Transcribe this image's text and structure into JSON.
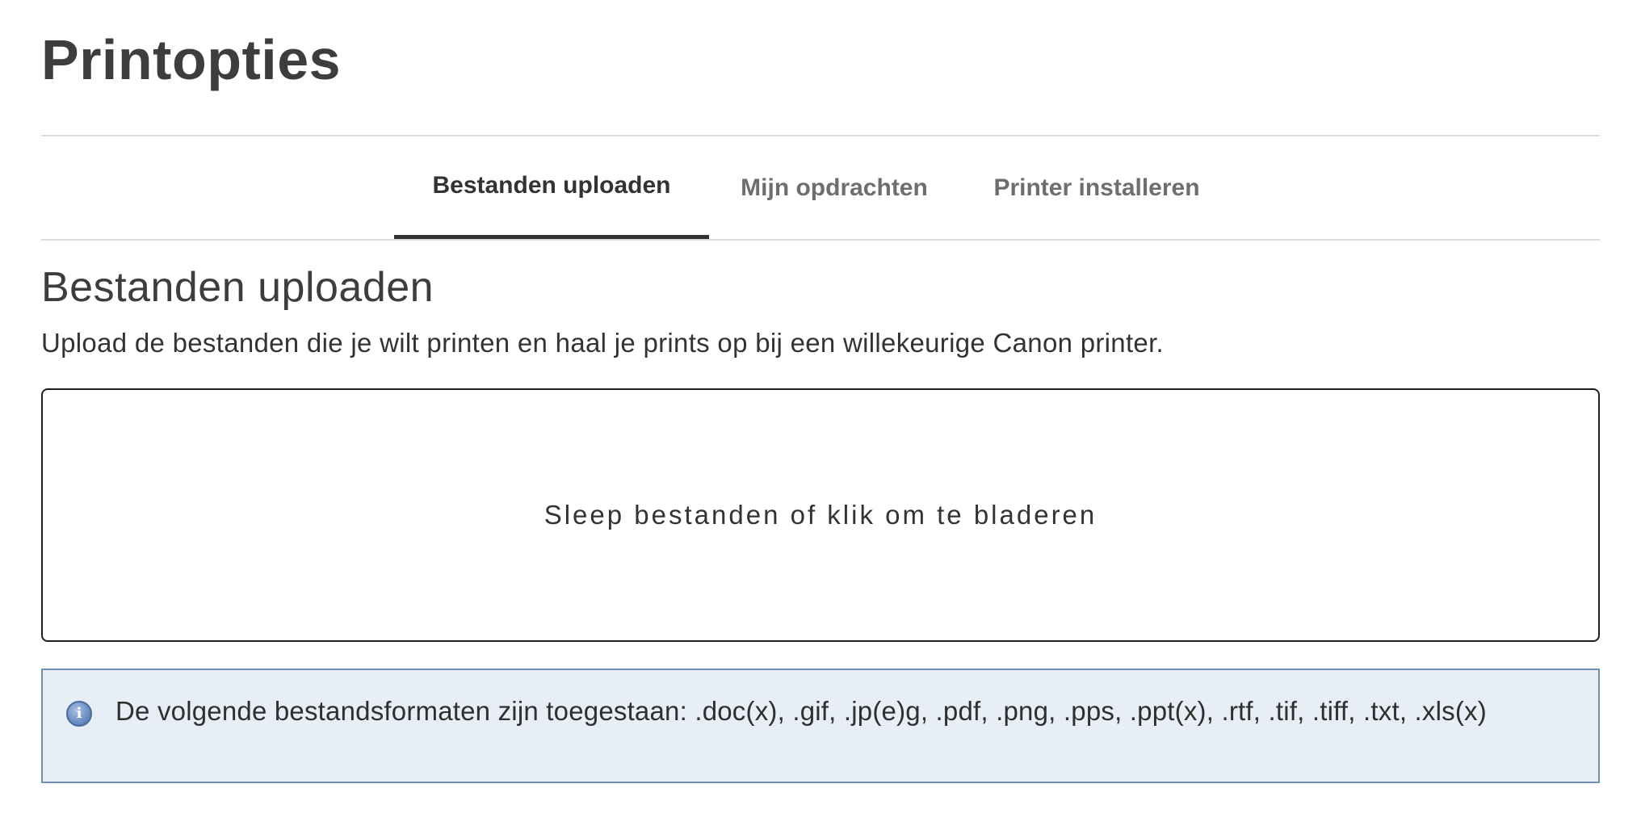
{
  "page": {
    "title": "Printopties"
  },
  "tabs": [
    {
      "label": "Bestanden uploaden",
      "active": true
    },
    {
      "label": "Mijn opdrachten",
      "active": false
    },
    {
      "label": "Printer installeren",
      "active": false
    }
  ],
  "section": {
    "title": "Bestanden uploaden",
    "description": "Upload de bestanden die je wilt printen en haal je prints op bij een willekeurige Canon printer."
  },
  "dropzone": {
    "label": "Sleep bestanden of klik om te bladeren"
  },
  "info": {
    "icon": "info-icon",
    "text": "De volgende bestandsformaten zijn toegestaan: .doc(x), .gif, .jp(e)g, .pdf, .png, .pps, .ppt(x), .rtf, .tif, .tiff, .txt, .xls(x)"
  },
  "colors": {
    "info_background": "#e8eef5",
    "info_border": "#6f8fb3",
    "active_tab_underline": "#333333"
  }
}
